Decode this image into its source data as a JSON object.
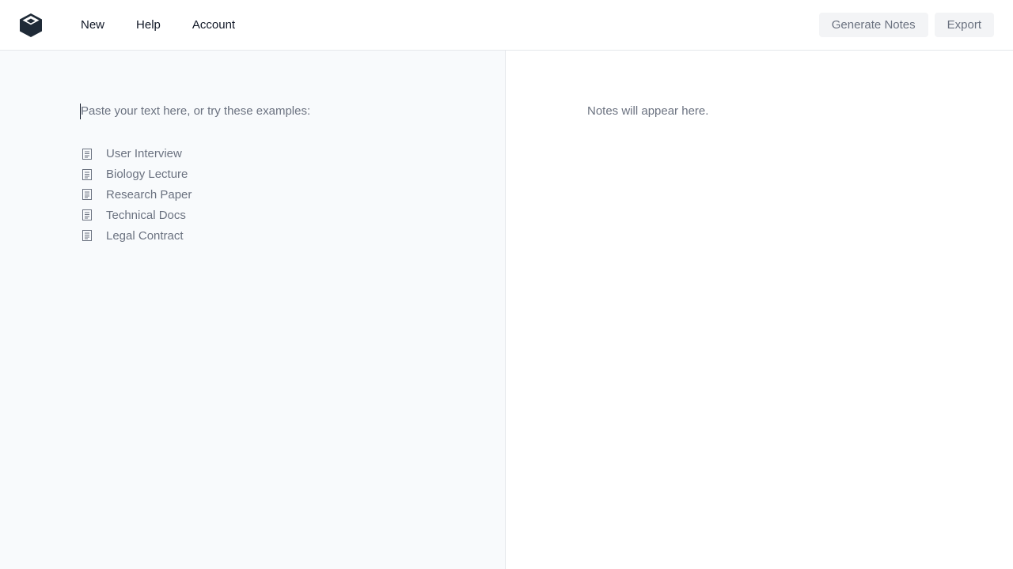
{
  "header": {
    "logo_icon": "cube-logo-icon",
    "nav": [
      {
        "label": "New"
      },
      {
        "label": "Help"
      },
      {
        "label": "Account"
      }
    ],
    "actions": {
      "generate_label": "Generate Notes",
      "export_label": "Export"
    }
  },
  "input_pane": {
    "placeholder": "Paste your text here, or try these examples:",
    "examples": [
      {
        "label": "User Interview",
        "icon": "document-icon"
      },
      {
        "label": "Biology Lecture",
        "icon": "document-icon"
      },
      {
        "label": "Research Paper",
        "icon": "document-icon"
      },
      {
        "label": "Technical Docs",
        "icon": "document-icon"
      },
      {
        "label": "Legal Contract",
        "icon": "document-icon"
      }
    ]
  },
  "notes_pane": {
    "placeholder": "Notes will appear here."
  },
  "colors": {
    "text_primary": "#111827",
    "text_muted": "#6b7280",
    "button_bg": "#f3f4f6",
    "left_bg": "#f8fafc",
    "border": "#e5e7eb",
    "logo": "#1f2a37"
  }
}
